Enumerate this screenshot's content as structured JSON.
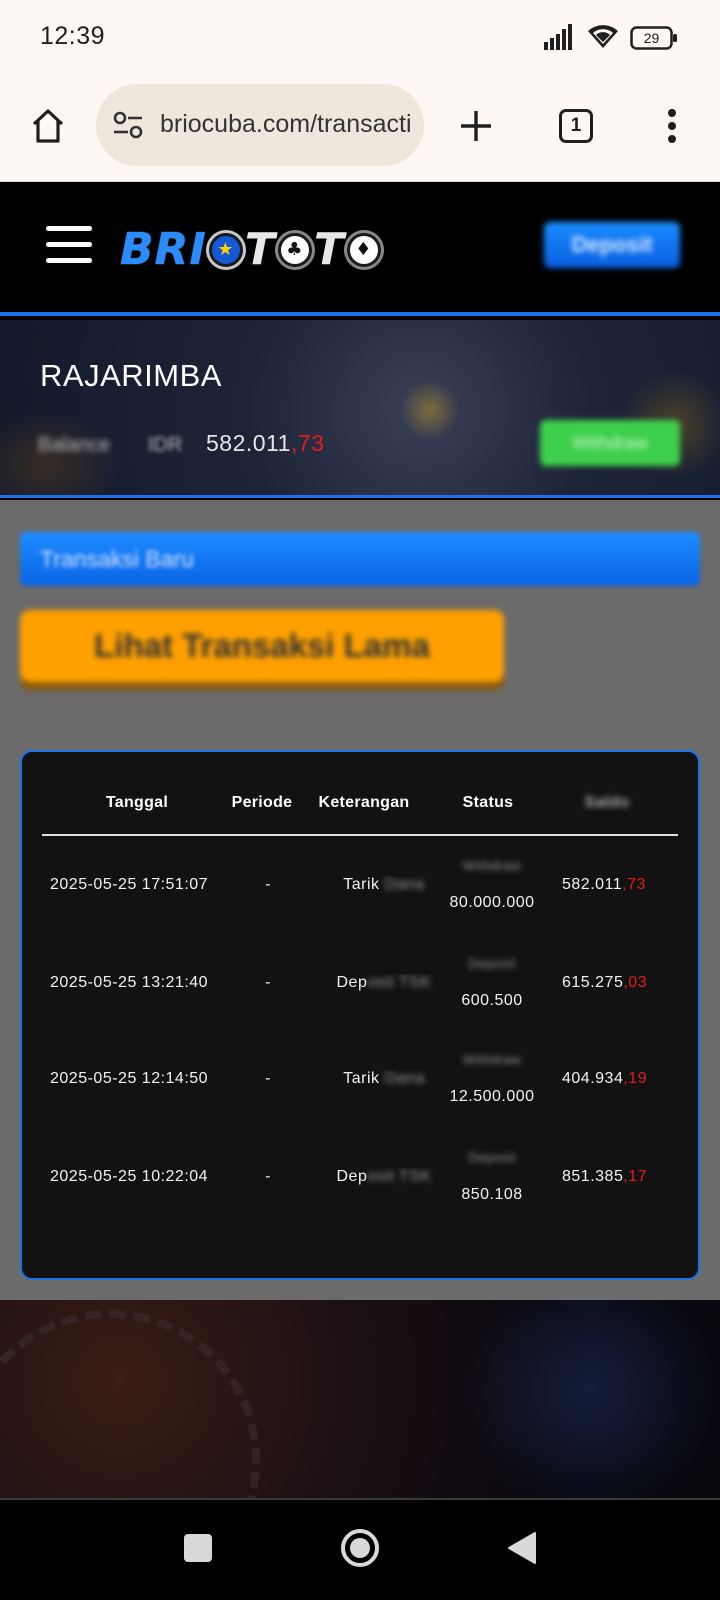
{
  "status_bar": {
    "time": "12:39",
    "battery": "29"
  },
  "browser": {
    "url": "briocuba.com/transaction",
    "tab_count": "1"
  },
  "site": {
    "logo_left": "BRI",
    "logo_mid": "T",
    "logo_right": "T",
    "deposit_button": "Deposit",
    "colors": {
      "primary": "#1a73e8",
      "withdraw": "#3ecf4c",
      "old_tx": "#ffa000",
      "negative": "#e51b1b"
    }
  },
  "account": {
    "username": "RAJARIMBA",
    "balance_label": "Balance",
    "currency": "IDR",
    "balance_main": "582.011",
    "balance_cents": ",73",
    "withdraw_button": "Withdraw"
  },
  "content": {
    "new_tx_label": "Transaksi Baru",
    "old_tx_label": "Lihat Transaksi Lama"
  },
  "table": {
    "headers": {
      "tanggal": "Tanggal",
      "periode": "Periode",
      "keterangan": "Keterangan",
      "status": "Status",
      "saldo": "Saldo"
    },
    "rows": [
      {
        "date": "2025-05-25 17:51:07",
        "periode": "-",
        "ket_prefix": "Tarik",
        "ket_rest": " Dana",
        "status_type": "Withdraw",
        "amount": "80.000.000",
        "saldo_main": "582.011",
        "saldo_cents": ",73"
      },
      {
        "date": "2025-05-25 13:21:40",
        "periode": "-",
        "ket_prefix": "Dep",
        "ket_rest": "osit TSK",
        "status_type": "Deposit",
        "amount": "600.500",
        "saldo_main": "615.275",
        "saldo_cents": ",03"
      },
      {
        "date": "2025-05-25 12:14:50",
        "periode": "-",
        "ket_prefix": "Tarik",
        "ket_rest": " Dana",
        "status_type": "Withdraw",
        "amount": "12.500.000",
        "saldo_main": "404.934",
        "saldo_cents": ",19"
      },
      {
        "date": "2025-05-25 10:22:04",
        "periode": "-",
        "ket_prefix": "Dep",
        "ket_rest": "osit TSK",
        "status_type": "Deposit",
        "amount": "850.108",
        "saldo_main": "851.385",
        "saldo_cents": ",17"
      }
    ]
  }
}
